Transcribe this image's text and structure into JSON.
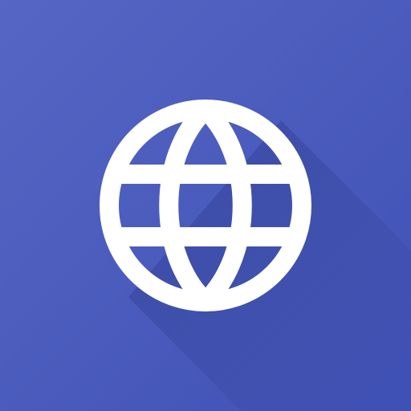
{
  "icon": {
    "name": "globe-icon",
    "background_color": "#3f51b5",
    "foreground_color": "#ffffff",
    "shadow_color": "#2c3a8c",
    "highlight_color": "#5566c4"
  }
}
